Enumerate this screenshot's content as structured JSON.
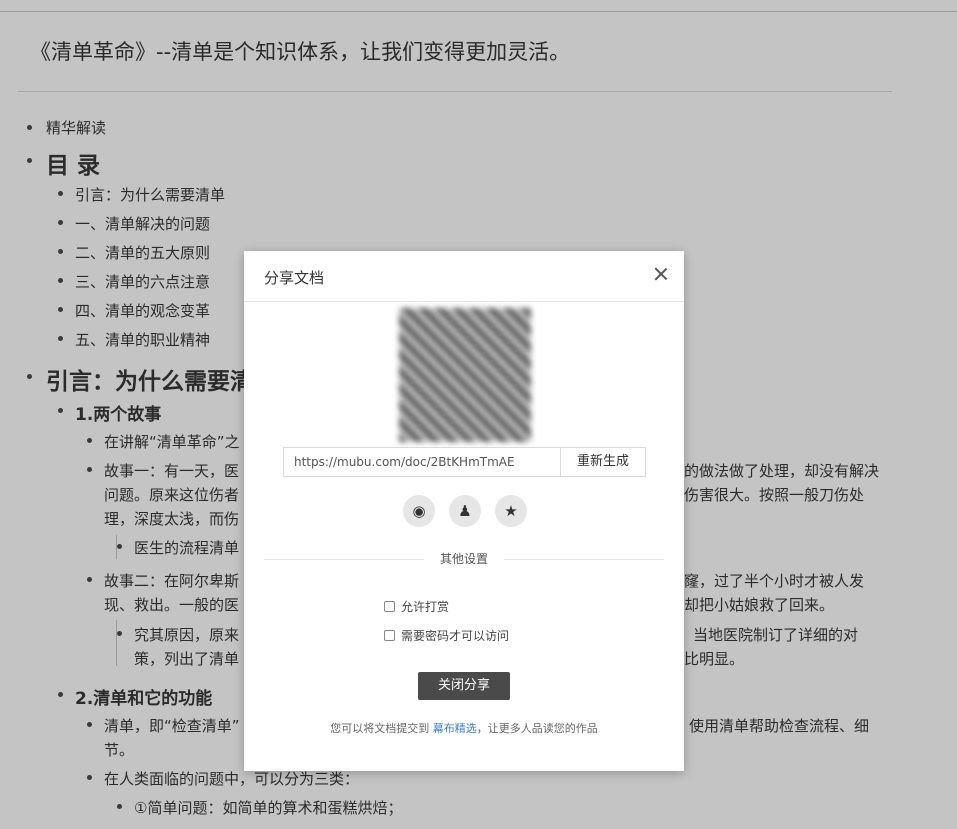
{
  "doc": {
    "title": "《清单革命》--清单是个知识体系，让我们变得更加灵活。",
    "lines": [
      {
        "kind": "l1",
        "text": "精华解读"
      },
      {
        "kind": "h1",
        "text": "目 录"
      },
      {
        "kind": "t",
        "text": "引言：为什么需要清单"
      },
      {
        "kind": "t",
        "text": "一、清单解决的问题"
      },
      {
        "kind": "t",
        "text": "二、清单的五大原则"
      },
      {
        "kind": "t",
        "text": "三、清单的六点注意"
      },
      {
        "kind": "t",
        "text": "四、清单的观念变革"
      },
      {
        "kind": "t",
        "text": "五、清单的职业精神"
      },
      {
        "kind": "h1",
        "text": "引言：为什么需要清单"
      },
      {
        "kind": "h2",
        "text": "1.两个故事"
      },
      {
        "kind": "t",
        "text": "在讲解“清单革命”之"
      },
      {
        "kind": "t",
        "text": "故事一：有一天，医"
      },
      {
        "kind": "t",
        "text": "的做法做了处理，却没有解决"
      },
      {
        "kind": "t",
        "text": "问题。原来这位伤者"
      },
      {
        "kind": "t",
        "text": "伤害很大。按照一般刀伤处"
      },
      {
        "kind": "t",
        "text": "理，深度太浅，而伤"
      },
      {
        "kind": "t",
        "text": "医生的流程清单"
      },
      {
        "kind": "t",
        "text": "故事二：在阿尔卑斯"
      },
      {
        "kind": "t",
        "text": "窿，过了半个小时才被人发"
      },
      {
        "kind": "t",
        "text": "现、救出。一般的医"
      },
      {
        "kind": "t",
        "text": "却把小姑娘救了回来。"
      },
      {
        "kind": "t",
        "text": "究其原因，原来"
      },
      {
        "kind": "t",
        "text": "当地医院制订了详细的对"
      },
      {
        "kind": "t",
        "text": "策，列出了清单"
      },
      {
        "kind": "t",
        "text": "比明显。"
      },
      {
        "kind": "h2",
        "text": "2.清单和它的功能"
      },
      {
        "kind": "t",
        "text": "清单，即“检查清单”"
      },
      {
        "kind": "t",
        "text": "使用清单帮助检查流程、细"
      },
      {
        "kind": "t",
        "text": "节。"
      },
      {
        "kind": "t",
        "text": "在人类面临的问题中，可以分为三类："
      },
      {
        "kind": "t",
        "text": "①简单问题：如简单的算术和蛋糕烘焙；"
      }
    ]
  },
  "modal": {
    "title": "分享文档",
    "url": "https://mubu.com/doc/2BtKHmTmAE",
    "regenerate_label": "重新生成",
    "share_icons": [
      {
        "name": "weibo-icon",
        "glyph": "◉"
      },
      {
        "name": "qq-icon",
        "glyph": "♟"
      },
      {
        "name": "qzone-icon",
        "glyph": "★"
      }
    ],
    "other_settings_label": "其他设置",
    "allow_tips_label": "允许打赏",
    "require_password_label": "需要密码才可以访问",
    "close_share_label": "关闭分享",
    "footer_prefix": "您可以将文档提交到",
    "footer_link": "幕布精选",
    "footer_suffix": "，让更多人品读您的作品"
  }
}
